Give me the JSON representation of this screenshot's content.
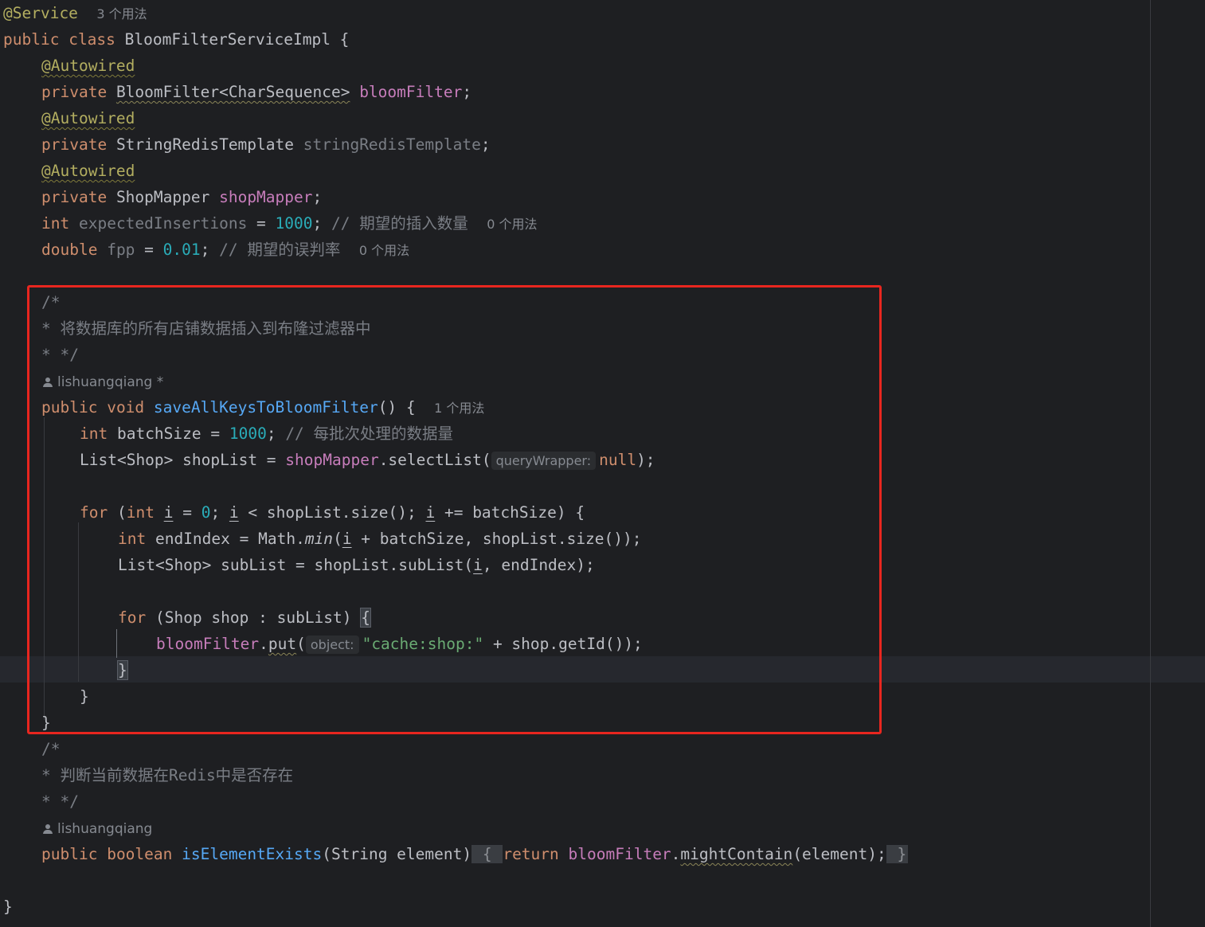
{
  "code": {
    "annotation_service": "@Service",
    "annotation_service_usages": "3 个用法",
    "class_decl": {
      "kw1": "public",
      "kw2": "class",
      "name": "BloomFilterServiceImpl {"
    },
    "autowired": "@Autowired",
    "field1": {
      "kw": "private",
      "type": "BloomFilter<CharSequence>",
      "name": "bloomFilter",
      "end": ";"
    },
    "field2": {
      "kw": "private",
      "type": "StringRedisTemplate",
      "name": "stringRedisTemplate",
      "end": ";"
    },
    "field3": {
      "kw": "private",
      "type": "ShopMapper",
      "name": "shopMapper",
      "end": ";"
    },
    "field4": {
      "kw": "int",
      "name": "expectedInsertions",
      "op": " = ",
      "val": "1000",
      "end": "; ",
      "comment": "// 期望的插入数量",
      "usages": "0 个用法"
    },
    "field5": {
      "kw": "double",
      "name": "fpp",
      "op": " = ",
      "val": "0.01",
      "end": "; ",
      "comment": "// 期望的误判率",
      "usages": "0 个用法"
    },
    "doc1": {
      "open": "/*",
      "body": "* 将数据库的所有店铺数据插入到布隆过滤器中",
      "close": "* */"
    },
    "author1": "lishuangqiang *",
    "method1": {
      "kw1": "public",
      "kw2": "void",
      "name": "saveAllKeysToBloomFilter",
      "sig_rest": "() {",
      "usages": "1 个用法"
    },
    "m1_l1": {
      "kw": "int",
      "rest": " batchSize = ",
      "val": "1000",
      "end": "; ",
      "comment": "// 每批次处理的数据量"
    },
    "m1_l2": {
      "start": "List<Shop> shopList = ",
      "fld": "shopMapper",
      "call": ".selectList(",
      "hint": "queryWrapper:",
      "kw": "null",
      "end": ");"
    },
    "m1_for": {
      "kw": "for",
      "p1": " (",
      "kw2": "int",
      "v1": "i",
      "p2": " = ",
      "zero": "0",
      "p3": "; ",
      "v2": "i",
      "p4": " < shopList.size(); ",
      "v3": "i",
      "p5": " += batchSize) {"
    },
    "m1_l3": {
      "kw": "int",
      "p1": " endIndex = Math.",
      "fn": "min",
      "p2": "(",
      "v": "i",
      "p3": " + batchSize, shopList.size());"
    },
    "m1_l4": {
      "p1": "List<Shop> subList = shopList.subList(",
      "v": "i",
      "p2": ", endIndex);"
    },
    "m1_for2": {
      "kw": "for",
      "p1": " (Shop shop : subList) ",
      "brace": "{"
    },
    "m1_put": {
      "fld": "bloomFilter",
      "dot": ".",
      "call": "put",
      "p1": "(",
      "hint": "object:",
      "str": "\"cache:shop:\"",
      "p2": " + shop.getId());"
    },
    "close_inner": "}",
    "close_for": "}",
    "close_method": "}",
    "doc2": {
      "open": "/*",
      "body": "* 判断当前数据在Redis中是否存在",
      "close": "* */"
    },
    "author2": "lishuangqiang",
    "method2": {
      "kw1": "public",
      "kw2": "boolean",
      "name": "isElementExists",
      "params": "(String element)",
      "fold_open": " { ",
      "ret": "return",
      "fld": "bloomFilter",
      "dot": ".",
      "call": "mightContain",
      "args": "(element);",
      "fold_close": " }"
    },
    "class_close": "}"
  }
}
